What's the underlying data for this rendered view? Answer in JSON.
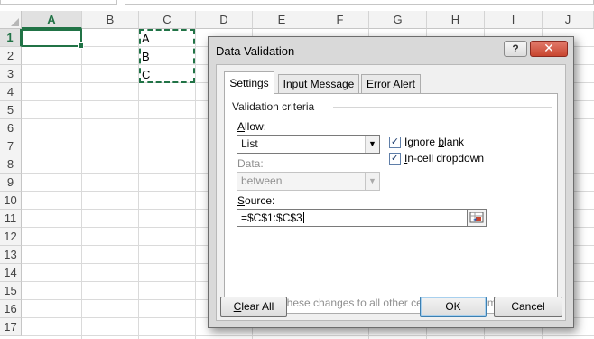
{
  "columns": [
    "A",
    "B",
    "C",
    "D",
    "E",
    "F",
    "G",
    "H",
    "I",
    "J"
  ],
  "rows": [
    "1",
    "2",
    "3",
    "4",
    "5",
    "6",
    "7",
    "8",
    "9",
    "10",
    "11",
    "12",
    "13",
    "14",
    "15",
    "16",
    "17"
  ],
  "cells": {
    "C1": "A",
    "C2": "B",
    "C3": "C"
  },
  "colors": {
    "excel_green": "#217346",
    "close_red": "#c8452f"
  },
  "dialog": {
    "title": "Data Validation",
    "help_glyph": "?",
    "close_glyph": "✕",
    "tabs": [
      {
        "label": "Settings",
        "active": true
      },
      {
        "label": "Input Message",
        "active": false
      },
      {
        "label": "Error Alert",
        "active": false
      }
    ],
    "section_title": "Validation criteria",
    "allow": {
      "label_first": "A",
      "label_rest": "llow:",
      "value": "List"
    },
    "data": {
      "label": "Data:",
      "value": "between"
    },
    "ignore_blank": {
      "label_pre": "Ignore ",
      "label_u": "b",
      "label_post": "lank",
      "checked": true
    },
    "in_cell_dropdown": {
      "label_u": "I",
      "label_post": "n-cell dropdown",
      "checked": true
    },
    "source": {
      "label_first": "S",
      "label_rest": "ource:",
      "value": "=$C$1:$C$3"
    },
    "apply_all": {
      "label": "Apply these changes to all other cells with the same settings",
      "checked": false
    },
    "buttons": {
      "clear_all_u": "C",
      "clear_all_rest": "lear All",
      "ok": "OK",
      "cancel": "Cancel"
    }
  }
}
